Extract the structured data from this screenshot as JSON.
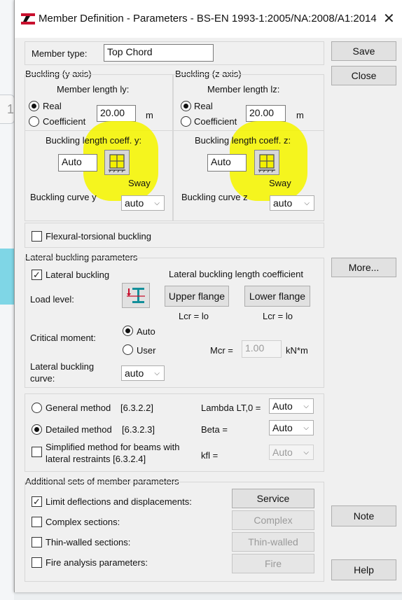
{
  "window": {
    "title": "Member Definition - Parameters - BS-EN 1993-1:2005/NA:2008/A1:2014",
    "close_glyph": "✕"
  },
  "member": {
    "type_label": "Member type:",
    "type_value": "Top Chord"
  },
  "buckling_y": {
    "group_label": "Buckling (y axis)",
    "length_label": "Member length ly:",
    "real_label": "Real",
    "coeff_label": "Coefficient",
    "value": "20.00",
    "unit": "m",
    "coeff_title": "Buckling length coeff. y:",
    "coeff_value": "Auto",
    "sway_label": "Sway",
    "curve_label": "Buckling curve y",
    "curve_value": "auto"
  },
  "buckling_z": {
    "group_label": "Buckling (z axis)",
    "length_label": "Member length lz:",
    "real_label": "Real",
    "coeff_label": "Coefficient",
    "value": "20.00",
    "unit": "m",
    "coeff_title": "Buckling length coeff. z:",
    "coeff_value": "Auto",
    "sway_label": "Sway",
    "curve_label": "Buckling curve z",
    "curve_value": "auto"
  },
  "flexural": {
    "label": "Flexural-torsional buckling",
    "checked": false
  },
  "lateral": {
    "group_label": "Lateral buckling parameters",
    "checkbox_label": "Lateral buckling",
    "length_coeff_label": "Lateral buckling length coefficient",
    "load_level_label": "Load level:",
    "upper_flange": "Upper flange",
    "lower_flange": "Lower flange",
    "lcr_upper": "Lcr =  lo",
    "lcr_lower": "Lcr =  lo",
    "critical_moment_label": "Critical moment:",
    "auto_label": "Auto",
    "user_label": "User",
    "mcr_label": "Mcr =",
    "mcr_value": "1.00",
    "mcr_unit": "kN*m",
    "curve_label_1": "Lateral buckling",
    "curve_label_2": "curve:",
    "curve_value": "auto"
  },
  "methods": {
    "general_label": "General method",
    "general_ref": "[6.3.2.2]",
    "detailed_label": "Detailed method",
    "detailed_ref": "[6.3.2.3]",
    "simplified_label_1": "Simplified method for beams with",
    "simplified_label_2": "lateral restraints [6.3.2.4]",
    "lambda_label": "Lambda LT,0 =",
    "lambda_value": "Auto",
    "beta_label": "Beta =",
    "beta_value": "Auto",
    "kfl_label": "kfl =",
    "kfl_value": "Auto"
  },
  "additional": {
    "group_label": "Additional sets of member parameters",
    "limit_label": "Limit deflections and displacements:",
    "service_button": "Service",
    "complex_label": "Complex sections:",
    "complex_button": "Complex",
    "thin_label": "Thin-walled sections:",
    "thin_button": "Thin-walled",
    "fire_label": "Fire analysis parameters:",
    "fire_button": "Fire"
  },
  "buttons": {
    "save": "Save",
    "close": "Close",
    "more": "More...",
    "note": "Note",
    "help": "Help"
  },
  "colors": {
    "highlight": "#f5f500",
    "dialog_bg": "#f0f0f0",
    "icon_red": "#c8102e",
    "icon_teal": "#138f9a"
  },
  "checkmark": "✓",
  "background": {
    "partial_char": "1"
  }
}
